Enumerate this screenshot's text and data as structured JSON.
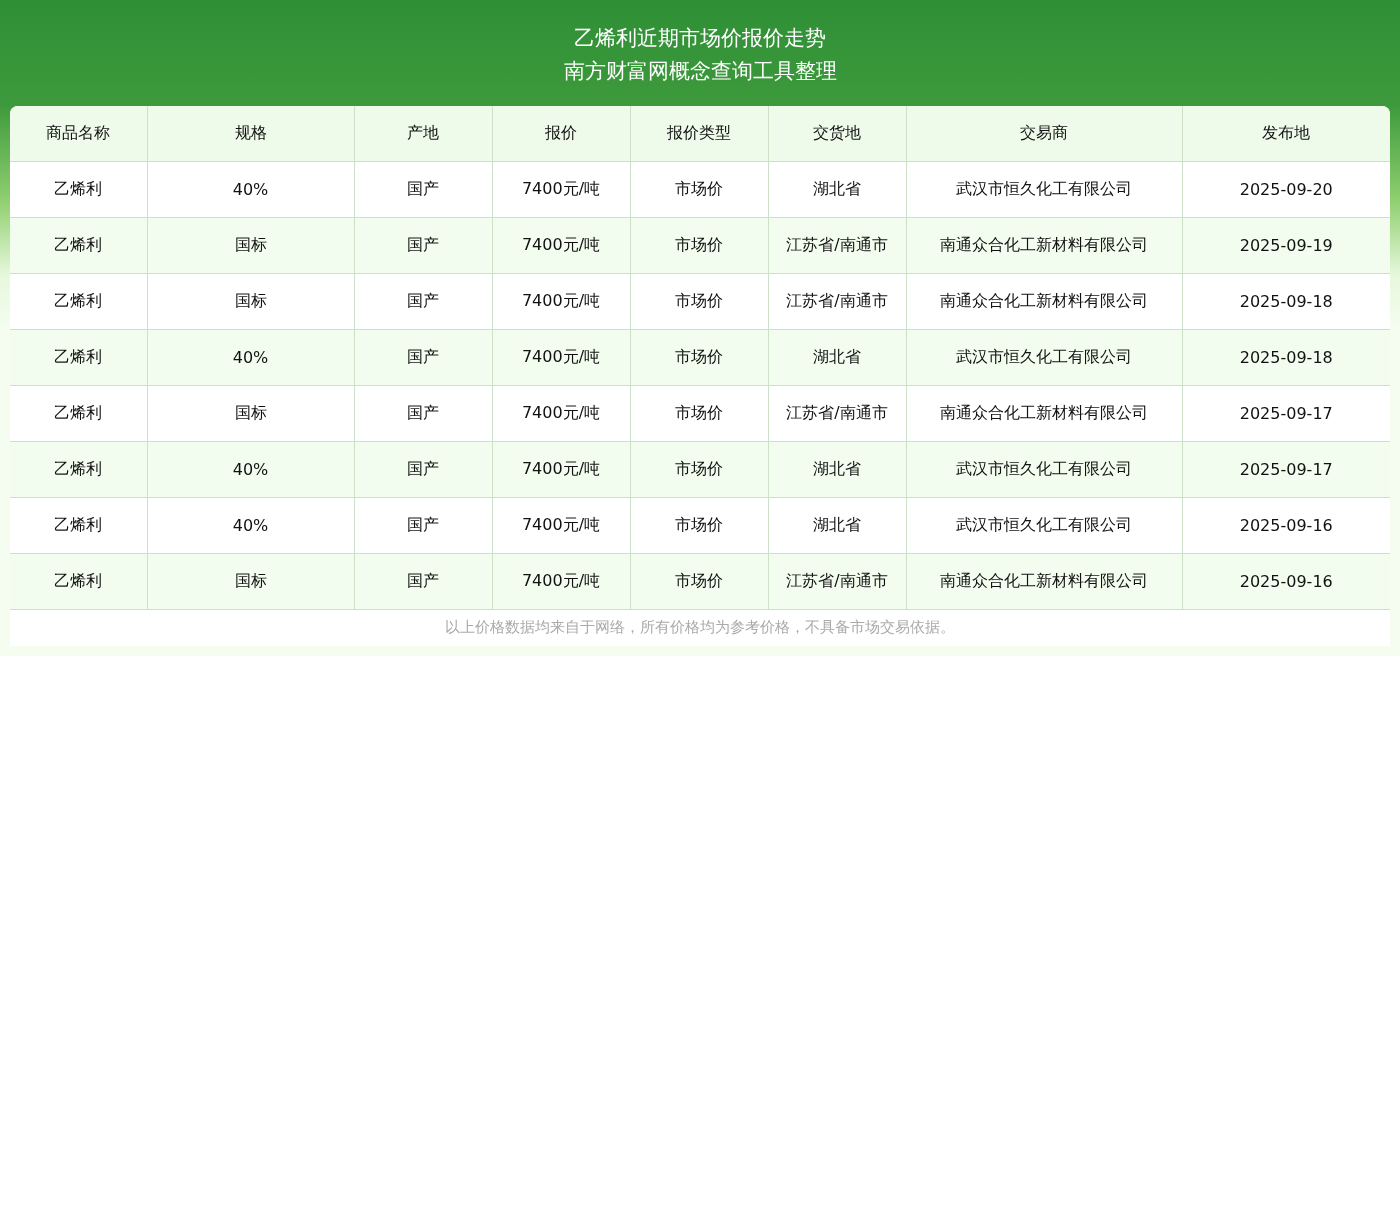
{
  "header": {
    "title": "乙烯利近期市场价报价走势",
    "subtitle": "南方财富网概念查询工具整理"
  },
  "table": {
    "columns": [
      "商品名称",
      "规格",
      "产地",
      "报价",
      "报价类型",
      "交货地",
      "交易商",
      "发布地"
    ],
    "rows": [
      [
        "乙烯利",
        "40%",
        "国产",
        "7400元/吨",
        "市场价",
        "湖北省",
        "武汉市恒久化工有限公司",
        "2025-09-20"
      ],
      [
        "乙烯利",
        "国标",
        "国产",
        "7400元/吨",
        "市场价",
        "江苏省/南通市",
        "南通众合化工新材料有限公司",
        "2025-09-19"
      ],
      [
        "乙烯利",
        "国标",
        "国产",
        "7400元/吨",
        "市场价",
        "江苏省/南通市",
        "南通众合化工新材料有限公司",
        "2025-09-18"
      ],
      [
        "乙烯利",
        "40%",
        "国产",
        "7400元/吨",
        "市场价",
        "湖北省",
        "武汉市恒久化工有限公司",
        "2025-09-18"
      ],
      [
        "乙烯利",
        "国标",
        "国产",
        "7400元/吨",
        "市场价",
        "江苏省/南通市",
        "南通众合化工新材料有限公司",
        "2025-09-17"
      ],
      [
        "乙烯利",
        "40%",
        "国产",
        "7400元/吨",
        "市场价",
        "湖北省",
        "武汉市恒久化工有限公司",
        "2025-09-17"
      ],
      [
        "乙烯利",
        "40%",
        "国产",
        "7400元/吨",
        "市场价",
        "湖北省",
        "武汉市恒久化工有限公司",
        "2025-09-16"
      ],
      [
        "乙烯利",
        "国标",
        "国产",
        "7400元/吨",
        "市场价",
        "江苏省/南通市",
        "南通众合化工新材料有限公司",
        "2025-09-16"
      ]
    ]
  },
  "footnote": "以上价格数据均来自于网络，所有价格均为参考价格，不具备市场交易依据。"
}
